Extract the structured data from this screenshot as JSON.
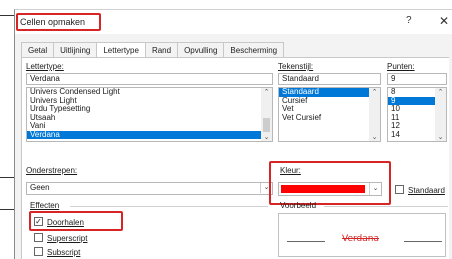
{
  "dialog": {
    "title": "Cellen opmaken",
    "help": "?",
    "close": "✕"
  },
  "tabs": [
    "Getal",
    "Uitlijning",
    "Lettertype",
    "Rand",
    "Opvulling",
    "Bescherming"
  ],
  "active_tab": "Lettertype",
  "font": {
    "label": "Lettertype:",
    "value": "Verdana",
    "items": [
      "Univers Condensed Light",
      "Univers Light",
      "Urdu Typesetting",
      "Utsaah",
      "Vani",
      "Verdana"
    ],
    "selected": "Verdana"
  },
  "style": {
    "label": "Tekenstijl:",
    "value": "Standaard",
    "items": [
      "Standaard",
      "Cursief",
      "Vet",
      "Vet Cursief"
    ],
    "selected": "Standaard"
  },
  "size": {
    "label": "Punten:",
    "value": "9",
    "items": [
      "8",
      "9",
      "10",
      "11",
      "12",
      "14"
    ],
    "selected": "9"
  },
  "underline": {
    "label": "Onderstrepen:",
    "value": "Geen"
  },
  "color": {
    "label": "Kleur:",
    "swatch": "#ff0000",
    "normal_label": "Standaard"
  },
  "effects": {
    "label": "Effecten",
    "strikethrough": "Doorhalen",
    "strikethrough_checked": true,
    "superscript": "Superscript",
    "subscript": "Subscript"
  },
  "preview": {
    "label": "Voorbeeld",
    "text": "Verdana",
    "text_color": "#d72525"
  },
  "colors": {
    "accent": "#0078d7",
    "highlight_box": "#d72525"
  }
}
